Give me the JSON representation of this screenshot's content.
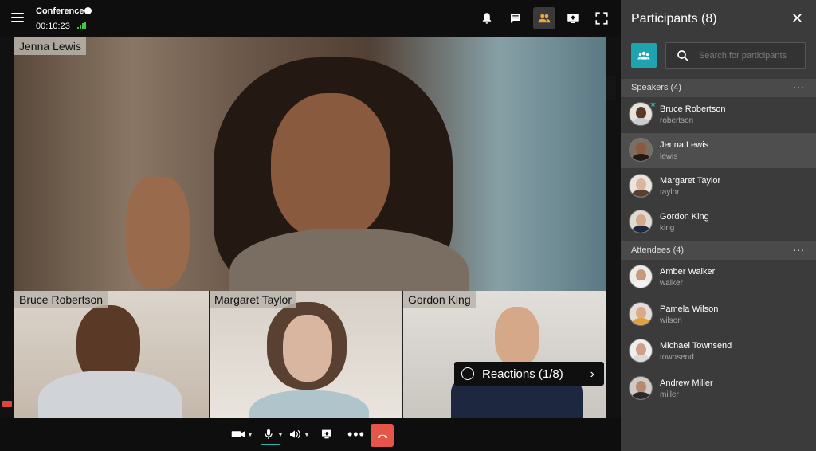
{
  "header": {
    "title": "Conference",
    "timer": "00:10:23"
  },
  "tiles": {
    "main": "Jenna Lewis",
    "small": [
      "Bruce Robertson",
      "Margaret Taylor",
      "Gordon King"
    ]
  },
  "reactions": {
    "label": "Reactions (1/8)"
  },
  "sidebar": {
    "title": "Participants (8)",
    "search_placeholder": "Search for participants",
    "speakers_label": "Speakers (4)",
    "attendees_label": "Attendees (4)",
    "speakers": [
      {
        "name": "Bruce Robertson",
        "username": "robertson"
      },
      {
        "name": "Jenna Lewis",
        "username": "lewis"
      },
      {
        "name": "Margaret Taylor",
        "username": "taylor"
      },
      {
        "name": "Gordon King",
        "username": "king"
      }
    ],
    "attendees": [
      {
        "name": "Amber Walker",
        "username": "walker"
      },
      {
        "name": "Pamela Wilson",
        "username": "wilson"
      },
      {
        "name": "Michael Townsend",
        "username": "townsend"
      },
      {
        "name": "Andrew Miller",
        "username": "miller"
      }
    ]
  },
  "controls": {
    "mic_level": 1.0
  },
  "colors": {
    "accent": "#1ea4b0",
    "hangup": "#e5554a",
    "signal": "#3ec84a"
  },
  "icons": [
    "menu-icon",
    "info-icon",
    "signal-icon",
    "bell-icon",
    "chat-icon",
    "participants-icon",
    "share-screen-icon",
    "fullscreen-icon",
    "camera-icon",
    "microphone-icon",
    "speaker-icon",
    "screen-share-icon",
    "more-icon",
    "hangup-icon",
    "close-icon",
    "group-icon",
    "search-icon",
    "smile-icon",
    "chevron-right-icon",
    "star-icon"
  ]
}
